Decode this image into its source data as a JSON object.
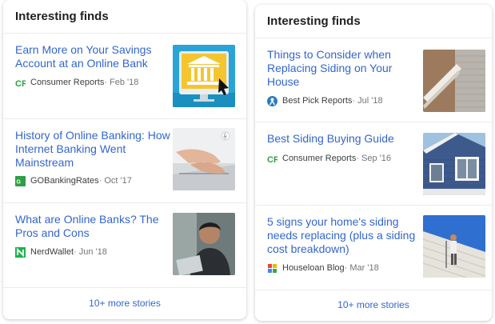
{
  "left_card": {
    "header": "Interesting finds",
    "stories": [
      {
        "title_line1": "Earn More on Your Savings",
        "title_line2": "Account at an Online Bank",
        "source": "Consumer Reports",
        "date": " · Feb '18",
        "icon": "consumer-reports-icon"
      },
      {
        "title_line1": "History of Online Banking: How",
        "title_line2": "Internet Banking Went",
        "title_line3": "Mainstream",
        "source": "GOBankingRates",
        "date": " · Oct '17",
        "icon": "gobankingrates-icon"
      },
      {
        "title_line1": "What are Online Banks? The",
        "title_line2": "Pros and Cons",
        "source": "NerdWallet",
        "date": " · Jun '18",
        "icon": "nerdwallet-icon"
      }
    ],
    "more_link": "10+ more stories"
  },
  "right_card": {
    "header": "Interesting finds",
    "stories": [
      {
        "title_line1": "Things to Consider when",
        "title_line2": "Replacing Siding on Your",
        "title_line3": "House",
        "source": "Best Pick Reports",
        "date": " · Jul '18",
        "icon": "best-pick-reports-icon"
      },
      {
        "title_line1": "Best Siding Buying Guide",
        "source": "Consumer Reports",
        "date": " · Sep '16",
        "icon": "consumer-reports-icon"
      },
      {
        "title_line1": "5 signs your home's siding",
        "title_line2": "needs replacing (plus a siding",
        "title_line3": "cost breakdown)",
        "source": "Houseloan Blog",
        "date": " · Mar '18",
        "icon": "houseloan-blog-icon"
      }
    ],
    "more_link": "10+ more stories"
  },
  "colors": {
    "link": "#3366cc",
    "header_text": "#202124",
    "meta_text": "#70757a",
    "divider": "#ebebeb"
  }
}
